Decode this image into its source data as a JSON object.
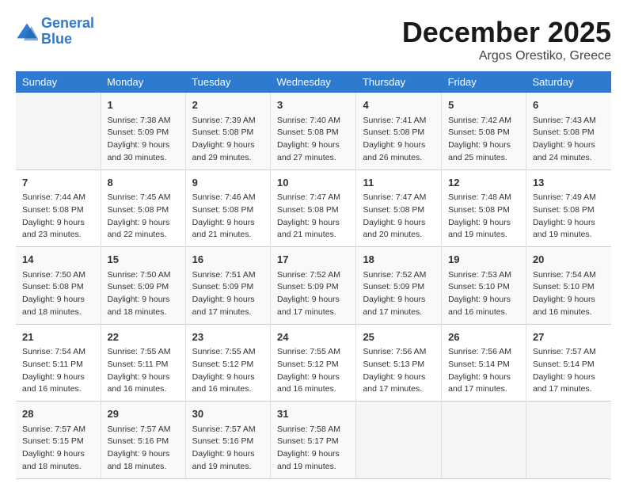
{
  "logo": {
    "line1": "General",
    "line2": "Blue"
  },
  "title": "December 2025",
  "subtitle": "Argos Orestiko, Greece",
  "days_of_week": [
    "Sunday",
    "Monday",
    "Tuesday",
    "Wednesday",
    "Thursday",
    "Friday",
    "Saturday"
  ],
  "weeks": [
    [
      {
        "day": "",
        "info": ""
      },
      {
        "day": "1",
        "info": "Sunrise: 7:38 AM\nSunset: 5:09 PM\nDaylight: 9 hours\nand 30 minutes."
      },
      {
        "day": "2",
        "info": "Sunrise: 7:39 AM\nSunset: 5:08 PM\nDaylight: 9 hours\nand 29 minutes."
      },
      {
        "day": "3",
        "info": "Sunrise: 7:40 AM\nSunset: 5:08 PM\nDaylight: 9 hours\nand 27 minutes."
      },
      {
        "day": "4",
        "info": "Sunrise: 7:41 AM\nSunset: 5:08 PM\nDaylight: 9 hours\nand 26 minutes."
      },
      {
        "day": "5",
        "info": "Sunrise: 7:42 AM\nSunset: 5:08 PM\nDaylight: 9 hours\nand 25 minutes."
      },
      {
        "day": "6",
        "info": "Sunrise: 7:43 AM\nSunset: 5:08 PM\nDaylight: 9 hours\nand 24 minutes."
      }
    ],
    [
      {
        "day": "7",
        "info": "Sunrise: 7:44 AM\nSunset: 5:08 PM\nDaylight: 9 hours\nand 23 minutes."
      },
      {
        "day": "8",
        "info": "Sunrise: 7:45 AM\nSunset: 5:08 PM\nDaylight: 9 hours\nand 22 minutes."
      },
      {
        "day": "9",
        "info": "Sunrise: 7:46 AM\nSunset: 5:08 PM\nDaylight: 9 hours\nand 21 minutes."
      },
      {
        "day": "10",
        "info": "Sunrise: 7:47 AM\nSunset: 5:08 PM\nDaylight: 9 hours\nand 21 minutes."
      },
      {
        "day": "11",
        "info": "Sunrise: 7:47 AM\nSunset: 5:08 PM\nDaylight: 9 hours\nand 20 minutes."
      },
      {
        "day": "12",
        "info": "Sunrise: 7:48 AM\nSunset: 5:08 PM\nDaylight: 9 hours\nand 19 minutes."
      },
      {
        "day": "13",
        "info": "Sunrise: 7:49 AM\nSunset: 5:08 PM\nDaylight: 9 hours\nand 19 minutes."
      }
    ],
    [
      {
        "day": "14",
        "info": "Sunrise: 7:50 AM\nSunset: 5:08 PM\nDaylight: 9 hours\nand 18 minutes."
      },
      {
        "day": "15",
        "info": "Sunrise: 7:50 AM\nSunset: 5:09 PM\nDaylight: 9 hours\nand 18 minutes."
      },
      {
        "day": "16",
        "info": "Sunrise: 7:51 AM\nSunset: 5:09 PM\nDaylight: 9 hours\nand 17 minutes."
      },
      {
        "day": "17",
        "info": "Sunrise: 7:52 AM\nSunset: 5:09 PM\nDaylight: 9 hours\nand 17 minutes."
      },
      {
        "day": "18",
        "info": "Sunrise: 7:52 AM\nSunset: 5:09 PM\nDaylight: 9 hours\nand 17 minutes."
      },
      {
        "day": "19",
        "info": "Sunrise: 7:53 AM\nSunset: 5:10 PM\nDaylight: 9 hours\nand 16 minutes."
      },
      {
        "day": "20",
        "info": "Sunrise: 7:54 AM\nSunset: 5:10 PM\nDaylight: 9 hours\nand 16 minutes."
      }
    ],
    [
      {
        "day": "21",
        "info": "Sunrise: 7:54 AM\nSunset: 5:11 PM\nDaylight: 9 hours\nand 16 minutes."
      },
      {
        "day": "22",
        "info": "Sunrise: 7:55 AM\nSunset: 5:11 PM\nDaylight: 9 hours\nand 16 minutes."
      },
      {
        "day": "23",
        "info": "Sunrise: 7:55 AM\nSunset: 5:12 PM\nDaylight: 9 hours\nand 16 minutes."
      },
      {
        "day": "24",
        "info": "Sunrise: 7:55 AM\nSunset: 5:12 PM\nDaylight: 9 hours\nand 16 minutes."
      },
      {
        "day": "25",
        "info": "Sunrise: 7:56 AM\nSunset: 5:13 PM\nDaylight: 9 hours\nand 17 minutes."
      },
      {
        "day": "26",
        "info": "Sunrise: 7:56 AM\nSunset: 5:14 PM\nDaylight: 9 hours\nand 17 minutes."
      },
      {
        "day": "27",
        "info": "Sunrise: 7:57 AM\nSunset: 5:14 PM\nDaylight: 9 hours\nand 17 minutes."
      }
    ],
    [
      {
        "day": "28",
        "info": "Sunrise: 7:57 AM\nSunset: 5:15 PM\nDaylight: 9 hours\nand 18 minutes."
      },
      {
        "day": "29",
        "info": "Sunrise: 7:57 AM\nSunset: 5:16 PM\nDaylight: 9 hours\nand 18 minutes."
      },
      {
        "day": "30",
        "info": "Sunrise: 7:57 AM\nSunset: 5:16 PM\nDaylight: 9 hours\nand 19 minutes."
      },
      {
        "day": "31",
        "info": "Sunrise: 7:58 AM\nSunset: 5:17 PM\nDaylight: 9 hours\nand 19 minutes."
      },
      {
        "day": "",
        "info": ""
      },
      {
        "day": "",
        "info": ""
      },
      {
        "day": "",
        "info": ""
      }
    ]
  ]
}
